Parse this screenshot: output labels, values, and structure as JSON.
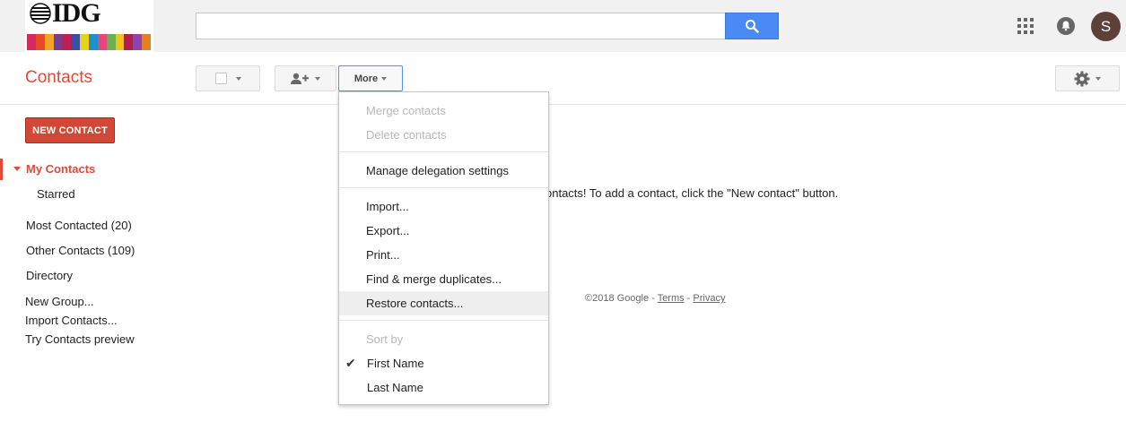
{
  "header": {
    "logo_text": "IDG",
    "search": {
      "value": "",
      "placeholder": ""
    },
    "avatar_initial": "S"
  },
  "toolbar": {
    "app_title": "Contacts",
    "more_label": "More"
  },
  "sidebar": {
    "new_contact_label": "NEW CONTACT",
    "my_contacts": "My Contacts",
    "starred": "Starred",
    "most_contacted": "Most Contacted (20)",
    "other_contacts": "Other Contacts (109)",
    "directory": "Directory",
    "new_group": "New Group...",
    "import_contacts": "Import Contacts...",
    "try_preview": "Try Contacts preview"
  },
  "main": {
    "empty_message": "ontacts! To add a contact, click the \"New contact\" button.",
    "footer": {
      "copyright": "©2018 Google - ",
      "sep": " - ",
      "terms": "Terms",
      "privacy": "Privacy"
    }
  },
  "menu": {
    "merge": "Merge contacts",
    "delete": "Delete contacts",
    "delegation": "Manage delegation settings",
    "import": "Import...",
    "export": "Export...",
    "print": "Print...",
    "find_merge": "Find & merge duplicates...",
    "restore": "Restore contacts...",
    "sort_by": "Sort by",
    "first_name": "First Name",
    "last_name": "Last Name"
  },
  "colors": {
    "brand_red": "#dd4b39",
    "search_blue": "#4a8af4",
    "logo_stripes": [
      "#d62a5e",
      "#e84a27",
      "#f2a521",
      "#7a3d8a",
      "#c21e56",
      "#3a4fa0",
      "#e8d21d",
      "#1f8fce",
      "#e3497a",
      "#6ab04c",
      "#f0c419",
      "#b11f4b",
      "#8e44ad",
      "#e67e22"
    ]
  }
}
